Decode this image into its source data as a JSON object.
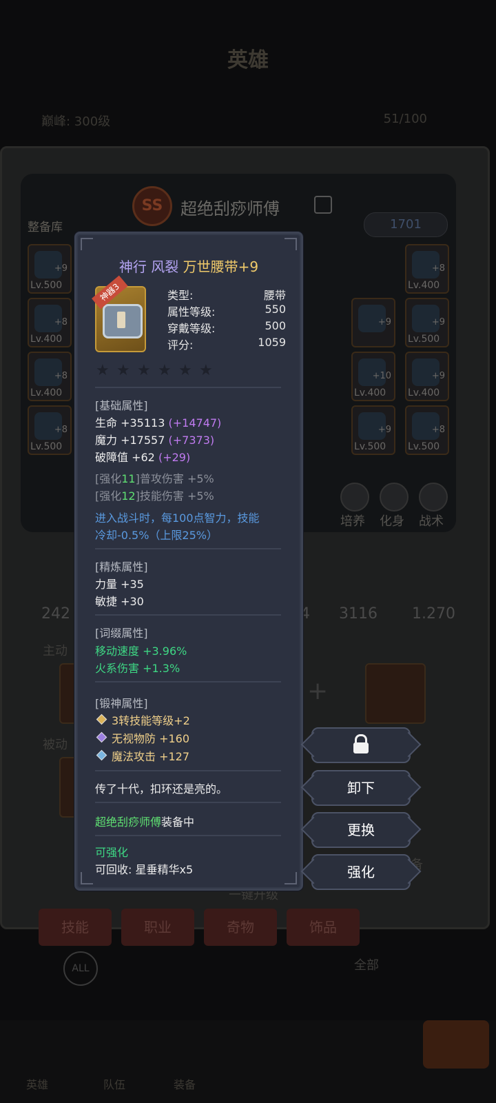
{
  "background": {
    "title": "英雄",
    "peak_label": "巅峰: 300级",
    "hero_count": "51/100",
    "depot_label": "整备库",
    "hero_name": "超绝刮痧师傅",
    "combat_power": "1701",
    "left_slots": [
      {
        "level": "Lv.500",
        "plus": "+9"
      },
      {
        "level": "Lv.400",
        "plus": "+8"
      },
      {
        "level": "Lv.400",
        "plus": "+8"
      },
      {
        "level": "Lv.500",
        "plus": "+8"
      }
    ],
    "right_slots": [
      {
        "level": "Lv.400",
        "plus": "+8"
      },
      {
        "level": "",
        "plus": "+9"
      },
      {
        "level": "Lv.500",
        "plus": "+9"
      },
      {
        "level": "Lv.400",
        "plus": "+10"
      },
      {
        "level": "Lv.400",
        "plus": "+9"
      },
      {
        "level": "Lv.500",
        "plus": "+9"
      },
      {
        "level": "Lv.500",
        "plus": "+8"
      }
    ],
    "panel_actions": [
      "培养",
      "化身",
      "战术"
    ],
    "stats": {
      "left": "242",
      "mid": "4",
      "val1": "3116",
      "val2": "1.270"
    },
    "section_active": "主动",
    "section_passive": "被动",
    "one_click_upgrade": "一键升级",
    "equip_label": "备",
    "tabs": [
      "技能",
      "职业",
      "奇物",
      "饰品"
    ],
    "filter_all": "ALL",
    "filter_label": "全部",
    "bottom_nav": [
      "英雄",
      "队伍",
      "装备"
    ]
  },
  "tooltip": {
    "title_prefix": "神行 风裂",
    "title_main": "万世腰带+9",
    "badge": "神器3",
    "info": [
      {
        "key": "类型:",
        "value": "腰带"
      },
      {
        "key": "属性等级:",
        "value": "550"
      },
      {
        "key": "穿戴等级:",
        "value": "500"
      },
      {
        "key": "评分:",
        "value": "1059"
      }
    ],
    "star_count": 6,
    "base_header": "[基础属性]",
    "base": [
      {
        "text": "生命 +35113",
        "bonus": "(+14747)"
      },
      {
        "text": "魔力 +17557",
        "bonus": "(+7373)"
      },
      {
        "text": "破障值 +62",
        "bonus": "(+29)"
      }
    ],
    "enhance": [
      {
        "pre": "[强化",
        "num": "11",
        "post": "]普攻伤害 +5%"
      },
      {
        "pre": "[强化",
        "num": "12",
        "post": "]技能伤害 +5%"
      }
    ],
    "passive_line1": "进入战斗时，每100点智力，技能",
    "passive_line2": "冷却-0.5%（上限25%）",
    "refine_header": "[精炼属性]",
    "refine": [
      "力量 +35",
      "敏捷 +30"
    ],
    "affix_header": "[词缀属性]",
    "affix": [
      "移动速度 +3.96%",
      "火系伤害 +1.3%"
    ],
    "forge_header": "[锻神属性]",
    "forge": [
      {
        "text": "3转技能等级+2",
        "color": "#d9b25a"
      },
      {
        "text": "无视物防 +160",
        "color": "#9b7fe0"
      },
      {
        "text": "魔法攻击 +127",
        "color": "#7bb6e0"
      }
    ],
    "flavor": "传了十代，扣环还是亮的。",
    "equipped_by": "超绝刮痧师傅",
    "equipped_suffix": "装备中",
    "enhanceable": "可强化",
    "recycle": "可回收: 星垂精华x5"
  },
  "actions": {
    "unlock_icon": "unlock-icon",
    "unequip": "卸下",
    "replace": "更换",
    "enhance": "强化"
  }
}
